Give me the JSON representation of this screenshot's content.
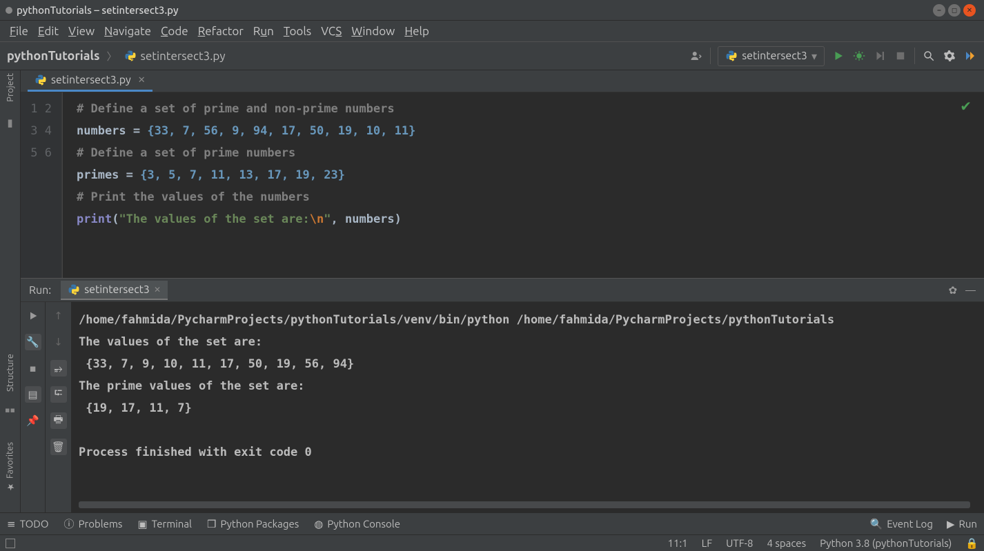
{
  "window": {
    "title": "pythonTutorials – setintersect3.py"
  },
  "menu": {
    "file": "File",
    "edit": "Edit",
    "view": "View",
    "navigate": "Navigate",
    "code": "Code",
    "refactor": "Refactor",
    "run": "Run",
    "tools": "Tools",
    "vcs": "VCS",
    "window": "Window",
    "help": "Help"
  },
  "breadcrumb": {
    "project": "pythonTutorials",
    "file": "setintersect3.py"
  },
  "runConfig": {
    "name": "setintersect3"
  },
  "editor": {
    "tab": "setintersect3.py",
    "lines": [
      "1",
      "2",
      "3",
      "4",
      "5",
      "6"
    ],
    "code": [
      {
        "type": "comment",
        "text": "# Define a set of prime and non-prime numbers"
      },
      {
        "type": "assign",
        "varname": "numbers",
        "values": "{33, 7, 56, 9, 94, 17, 50, 19, 10, 11}"
      },
      {
        "type": "comment",
        "text": "# Define a set of prime numbers"
      },
      {
        "type": "assign",
        "varname": "primes",
        "values": "{3, 5, 7, 11, 13, 17, 19, 23}"
      },
      {
        "type": "comment",
        "text": "# Print the values of the numbers"
      },
      {
        "type": "print",
        "str_prefix": "\"The values of the set are:",
        "esc": "\\n",
        "str_suffix": "\"",
        "arg": "numbers"
      }
    ]
  },
  "run": {
    "label": "Run:",
    "tab": "setintersect3",
    "output": [
      "/home/fahmida/PycharmProjects/pythonTutorials/venv/bin/python /home/fahmida/PycharmProjects/pythonTutorials",
      "The values of the set are:",
      " {33, 7, 9, 10, 11, 17, 50, 19, 56, 94}",
      "The prime values of the set are:",
      " {19, 17, 11, 7}",
      "",
      "Process finished with exit code 0"
    ]
  },
  "bottom": {
    "todo": "TODO",
    "problems": "Problems",
    "terminal": "Terminal",
    "packages": "Python Packages",
    "console": "Python Console",
    "eventlog": "Event Log",
    "run": "Run"
  },
  "status": {
    "pos": "11:1",
    "sep": "LF",
    "enc": "UTF-8",
    "indent": "4 spaces",
    "interp": "Python 3.8 (pythonTutorials)"
  },
  "sidebars": {
    "project": "Project",
    "structure": "Structure",
    "favorites": "Favorites"
  }
}
